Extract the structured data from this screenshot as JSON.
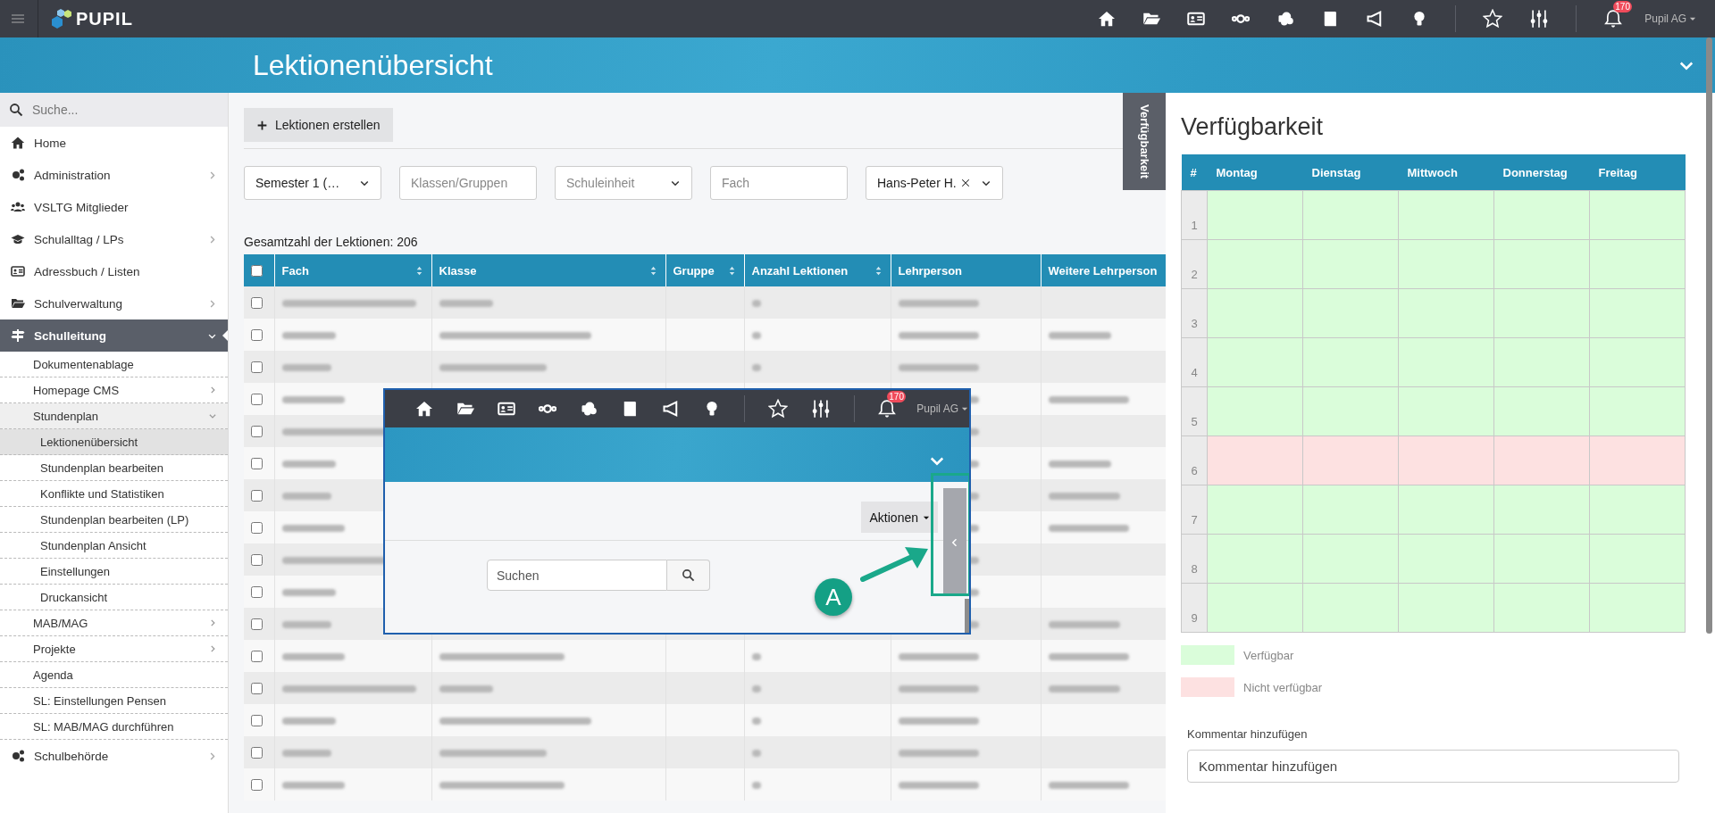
{
  "topbar": {
    "logo": "PUPIL",
    "notification_count": "170",
    "user": "Pupil AG"
  },
  "header": {
    "title": "Lektionenübersicht"
  },
  "sidebar": {
    "search_placeholder": "Suche...",
    "items": [
      {
        "label": "Home",
        "selected": false
      },
      {
        "label": "Administration",
        "selected": false,
        "expanded": false
      },
      {
        "label": "VSLTG Mitglieder",
        "selected": false
      },
      {
        "label": "Schulalltag / LPs",
        "selected": false,
        "expanded": false
      },
      {
        "label": "Adressbuch / Listen",
        "selected": false
      },
      {
        "label": "Schulverwaltung",
        "selected": false,
        "expanded": false
      },
      {
        "label": "Schulleitung",
        "selected": true,
        "expanded": true,
        "children": [
          {
            "label": "Dokumentenablage",
            "selected": false
          },
          {
            "label": "Homepage CMS",
            "selected": false,
            "expanded": false
          },
          {
            "label": "Stundenplan",
            "selected": false,
            "expanded": true,
            "children": [
              {
                "label": "Lektionenübersicht",
                "selected": true
              },
              {
                "label": "Stundenplan bearbeiten",
                "selected": false
              },
              {
                "label": "Konflikte und Statistiken",
                "selected": false
              },
              {
                "label": "Stundenplan bearbeiten (LP)",
                "selected": false
              },
              {
                "label": "Stundenplan Ansicht",
                "selected": false
              },
              {
                "label": "Einstellungen",
                "selected": false
              },
              {
                "label": "Druckansicht",
                "selected": false
              }
            ]
          },
          {
            "label": "MAB/MAG",
            "selected": false,
            "expanded": false
          },
          {
            "label": "Projekte",
            "selected": false,
            "expanded": false
          },
          {
            "label": "Agenda",
            "selected": false
          },
          {
            "label": "SL: Einstellungen Pensen",
            "selected": false
          },
          {
            "label": "SL: MAB/MAG durchführen",
            "selected": false
          }
        ]
      },
      {
        "label": "Schulbehörde",
        "selected": false,
        "expanded": false
      }
    ]
  },
  "toolbar": {
    "create_button": "Lektionen erstellen"
  },
  "filters": [
    {
      "kind": "select",
      "value": "Semester 1 (…"
    },
    {
      "kind": "input",
      "placeholder": "Klassen/Gruppen"
    },
    {
      "kind": "select",
      "placeholder": "Schuleinheit"
    },
    {
      "kind": "input",
      "placeholder": "Fach"
    },
    {
      "kind": "select",
      "value": "Hans-Peter H.",
      "has_clear_button": true
    }
  ],
  "total_label": "Gesamtzahl der Lektionen: 206",
  "side_tab": {
    "label": "Verfügbarkeit"
  },
  "table": {
    "select_all_checked": false,
    "columns": [
      {
        "label": "Fach",
        "sortable": true
      },
      {
        "label": "Klasse",
        "sortable": true
      },
      {
        "label": "Gruppe",
        "sortable": true
      },
      {
        "label": "Anzahl Lektionen",
        "sortable": true
      },
      {
        "label": "Lehrperson",
        "sortable": false
      },
      {
        "label": "Weitere Lehrperson",
        "sortable": false
      }
    ],
    "rows": [
      {
        "checked": false,
        "has_extra_teacher": false
      },
      {
        "checked": false,
        "has_extra_teacher": true
      },
      {
        "checked": false,
        "has_extra_teacher": false
      },
      {
        "checked": false,
        "has_extra_teacher": true
      },
      {
        "checked": false,
        "has_extra_teacher": false
      },
      {
        "checked": false,
        "has_extra_teacher": true
      },
      {
        "checked": false,
        "has_extra_teacher": true
      },
      {
        "checked": false,
        "has_extra_teacher": true
      },
      {
        "checked": false,
        "has_extra_teacher": false
      },
      {
        "checked": false,
        "has_extra_teacher": false
      },
      {
        "checked": false,
        "has_extra_teacher": true
      },
      {
        "checked": false,
        "has_extra_teacher": true
      },
      {
        "checked": false,
        "has_extra_teacher": true
      },
      {
        "checked": false,
        "has_extra_teacher": false
      },
      {
        "checked": false,
        "has_extra_teacher": false
      },
      {
        "checked": false,
        "has_extra_teacher": true
      }
    ]
  },
  "inset": {
    "notification_count": "170",
    "user": "Pupil AG",
    "actions_button": "Aktionen",
    "search_placeholder": "Suchen",
    "callout": "A"
  },
  "availability": {
    "title": "Verfügbarkeit",
    "columns": [
      "#",
      "Montag",
      "Dienstag",
      "Mittwoch",
      "Donnerstag",
      "Freitag"
    ],
    "rows": [
      {
        "label": "1",
        "cells": [
          true,
          true,
          true,
          true,
          true
        ]
      },
      {
        "label": "2",
        "cells": [
          true,
          true,
          true,
          true,
          true
        ]
      },
      {
        "label": "3",
        "cells": [
          true,
          true,
          true,
          true,
          true
        ]
      },
      {
        "label": "4",
        "cells": [
          true,
          true,
          true,
          true,
          true
        ]
      },
      {
        "label": "5",
        "cells": [
          true,
          true,
          true,
          true,
          true
        ]
      },
      {
        "label": "6",
        "cells": [
          false,
          false,
          false,
          false,
          false
        ]
      },
      {
        "label": "7",
        "cells": [
          true,
          true,
          true,
          true,
          true
        ]
      },
      {
        "label": "8",
        "cells": [
          true,
          true,
          true,
          true,
          true
        ]
      },
      {
        "label": "9",
        "cells": [
          true,
          true,
          true,
          true,
          true
        ]
      }
    ],
    "legend": [
      {
        "label": "Verfügbar",
        "color": "#dafdda"
      },
      {
        "label": "Nicht verfügbar",
        "color": "#fde1e1"
      }
    ],
    "comment": {
      "label": "Kommentar hinzufügen",
      "placeholder": "Kommentar hinzufügen"
    }
  }
}
